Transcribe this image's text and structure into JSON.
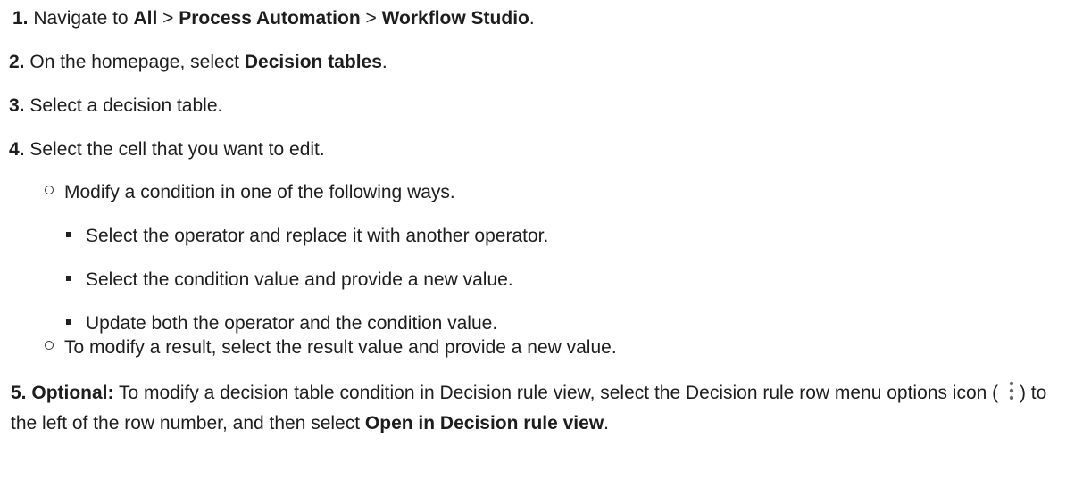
{
  "steps": [
    {
      "number": "1.",
      "parts": [
        {
          "t": "Navigate to ",
          "bold": false
        },
        {
          "t": "All",
          "bold": true
        },
        {
          "t": " > ",
          "bold": false
        },
        {
          "t": "Process Automation",
          "bold": true
        },
        {
          "t": " > ",
          "bold": false
        },
        {
          "t": "Workflow Studio",
          "bold": true
        },
        {
          "t": ".",
          "bold": false
        }
      ]
    },
    {
      "number": "2.",
      "parts": [
        {
          "t": "On the homepage, select ",
          "bold": false
        },
        {
          "t": "Decision tables",
          "bold": true
        },
        {
          "t": ".",
          "bold": false
        }
      ]
    },
    {
      "number": "3.",
      "text": "Select a decision table."
    },
    {
      "number": "4.",
      "text": "Select the cell that you want to edit.",
      "subitems": [
        {
          "text": "Modify a condition in one of the following ways.",
          "subitems": [
            "Select the operator and replace it with another operator.",
            "Select the condition value and provide a new value.",
            "Update both the operator and the condition value."
          ]
        },
        {
          "text": "To modify a result, select the result value and provide a new value."
        }
      ]
    },
    {
      "number": "5.",
      "label": "Optional:",
      "text_before_icon": " To modify a decision table condition in Decision rule view, select the Decision rule row menu options icon (",
      "icon": "vertical-dots-icon",
      "text_after_icon": ") to the left of the row number, and then select ",
      "bold_end": "Open in Decision rule view",
      "end": "."
    }
  ]
}
